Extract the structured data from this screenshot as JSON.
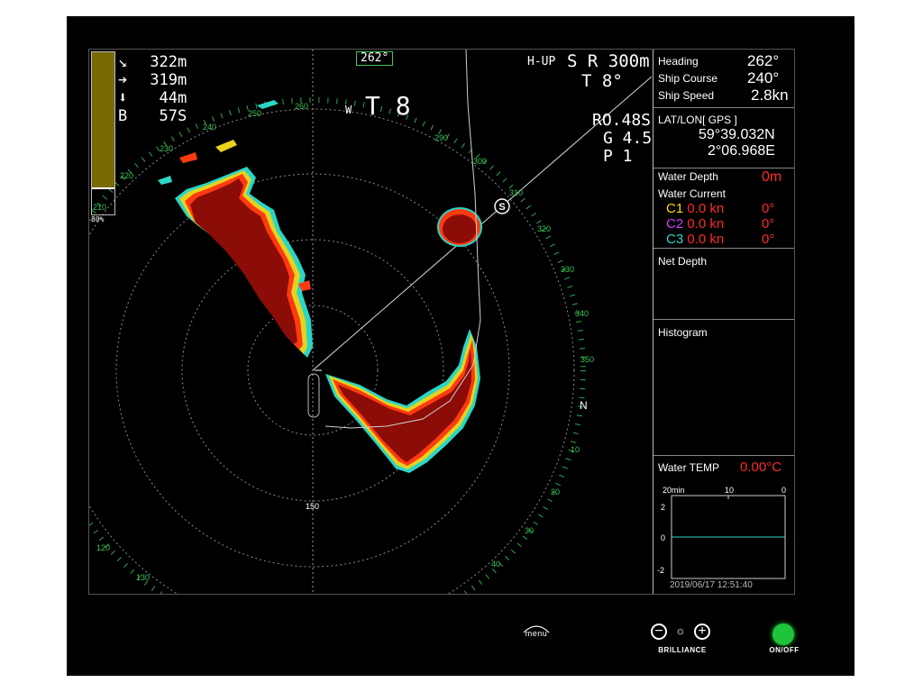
{
  "overlay": {
    "rows": [
      {
        "icon": "arrow-down-right-icon",
        "value": "322m"
      },
      {
        "icon": "arrow-right-icon",
        "value": "319m"
      },
      {
        "icon": "arrow-down-icon",
        "value": "44m"
      },
      {
        "icon": "",
        "label": "B",
        "value": "57S"
      }
    ],
    "bar_percent": "80%",
    "bar_color": "#7a6a06",
    "heading_box": "262°",
    "mode": "H-UP",
    "sr": "S R 300m",
    "t_angle": "T  8°",
    "w_label": "W",
    "t_big": "T 8",
    "ro": "RO.48S",
    "g": "G  4.5",
    "p": "P  1",
    "north": "N",
    "ship_marker": "S",
    "range_label": "150",
    "bearing_labels": [
      "210",
      "220",
      "230",
      "240",
      "250",
      "260",
      "290",
      "300",
      "310",
      "320",
      "330",
      "340",
      "350",
      "10",
      "20",
      "30",
      "40",
      "120",
      "130"
    ]
  },
  "panel": {
    "heading_label": "Heading",
    "heading_value": "262°",
    "course_label": "Ship Course",
    "course_value": "240°",
    "speed_label": "Ship Speed",
    "speed_value": "2.8kn",
    "latlon_label": "LAT/LON[ GPS ]",
    "lat": "59°39.032N",
    "lon": "2°06.968E",
    "depth_label": "Water Depth",
    "depth_value": "0m",
    "current_label": "Water Current",
    "currents": [
      {
        "name": "C1",
        "color": "#ffd400",
        "speed": "0.0 kn",
        "dir": "0°"
      },
      {
        "name": "C2",
        "color": "#d03cff",
        "speed": "0.0 kn",
        "dir": "0°"
      },
      {
        "name": "C3",
        "color": "#2ad6c6",
        "speed": "0.0 kn",
        "dir": "0°"
      }
    ],
    "net_depth_label": "Net Depth",
    "histogram_label": "Histogram",
    "temp_label": "Water TEMP",
    "temp_value": "0.00°C",
    "graph_x": [
      "20min",
      "10",
      "0"
    ],
    "graph_y": [
      "2",
      "0",
      "-2"
    ],
    "datetime": "2019/06/17 12:51:40"
  },
  "hardware": {
    "menu": "menu",
    "brilliance": "BRILLIANCE",
    "onoff": "ON/OFF",
    "power_color": "#1fc43a"
  }
}
